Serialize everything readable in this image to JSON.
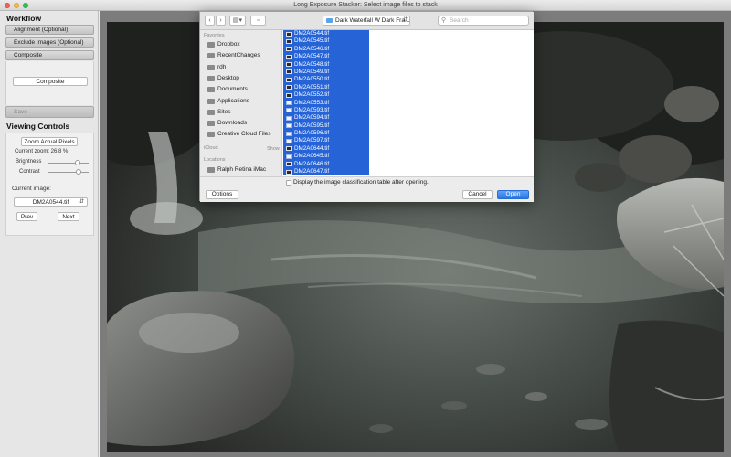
{
  "window": {
    "title": "Long Exposure Stacker: Select image files to stack",
    "light_colors": [
      "#fc605b",
      "#fdbc40",
      "#34c84a"
    ]
  },
  "sidebar": {
    "workflow_title": "Workflow",
    "workflow_steps": [
      "Alignment (Optional)",
      "Exclude Images (Optional)",
      "Composite"
    ],
    "composite_button": "Composite",
    "save_button": "Save",
    "viewing_title": "Viewing Controls",
    "zoom_button": "Zoom Actual Pixels",
    "current_zoom": "Current zoom: 26.8 %",
    "brightness_label": "Brightness",
    "contrast_label": "Contrast",
    "current_image_label": "Current image:",
    "current_image_value": "DM2A0544.tif",
    "prev_button": "Prev",
    "next_button": "Next"
  },
  "dialog": {
    "path": "Dark Waterfall W Dark Fra...",
    "search_placeholder": "Search",
    "favorites_header": "Favorites",
    "favorites": [
      {
        "label": "Dropbox",
        "icon": "dropbox-icon"
      },
      {
        "label": "RecentChanges",
        "icon": "gear-icon"
      },
      {
        "label": "rdh",
        "icon": "home-icon"
      },
      {
        "label": "Desktop",
        "icon": "desktop-icon"
      },
      {
        "label": "Documents",
        "icon": "documents-icon"
      },
      {
        "label": "Applications",
        "icon": "applications-icon"
      },
      {
        "label": "Sites",
        "icon": "folder-icon"
      },
      {
        "label": "Downloads",
        "icon": "downloads-icon"
      },
      {
        "label": "Creative Cloud Files",
        "icon": "folder-icon"
      }
    ],
    "icloud_header": "iCloud",
    "show_label": "Show",
    "locations_header": "Locations",
    "locations": [
      {
        "label": "Ralph Retina iMac",
        "icon": "imac-icon"
      }
    ],
    "files": [
      {
        "name": "DM2A0544.tif",
        "kind": "image"
      },
      {
        "name": "DM2A0545.tif",
        "kind": "image"
      },
      {
        "name": "DM2A0546.tif",
        "kind": "image"
      },
      {
        "name": "DM2A0547.tif",
        "kind": "image"
      },
      {
        "name": "DM2A0548.tif",
        "kind": "image"
      },
      {
        "name": "DM2A0549.tif",
        "kind": "image"
      },
      {
        "name": "DM2A0550.tif",
        "kind": "image"
      },
      {
        "name": "DM2A0551.tif",
        "kind": "image"
      },
      {
        "name": "DM2A0552.tif",
        "kind": "image"
      },
      {
        "name": "DM2A0553.tif",
        "kind": "doc"
      },
      {
        "name": "DM2A0593.tif",
        "kind": "doc"
      },
      {
        "name": "DM2A0594.tif",
        "kind": "doc"
      },
      {
        "name": "DM2A0595.tif",
        "kind": "doc"
      },
      {
        "name": "DM2A0596.tif",
        "kind": "doc"
      },
      {
        "name": "DM2A0597.tif",
        "kind": "doc"
      },
      {
        "name": "DM2A0644.tif",
        "kind": "image"
      },
      {
        "name": "DM2A0645.tif",
        "kind": "doc"
      },
      {
        "name": "DM2A0646.tif",
        "kind": "image"
      },
      {
        "name": "DM2A0647.tif",
        "kind": "image"
      }
    ],
    "checkbox_label": "Display the image classification table after opening.",
    "options_button": "Options",
    "cancel_button": "Cancel",
    "open_button": "Open",
    "selection_color": "#2563d6"
  }
}
